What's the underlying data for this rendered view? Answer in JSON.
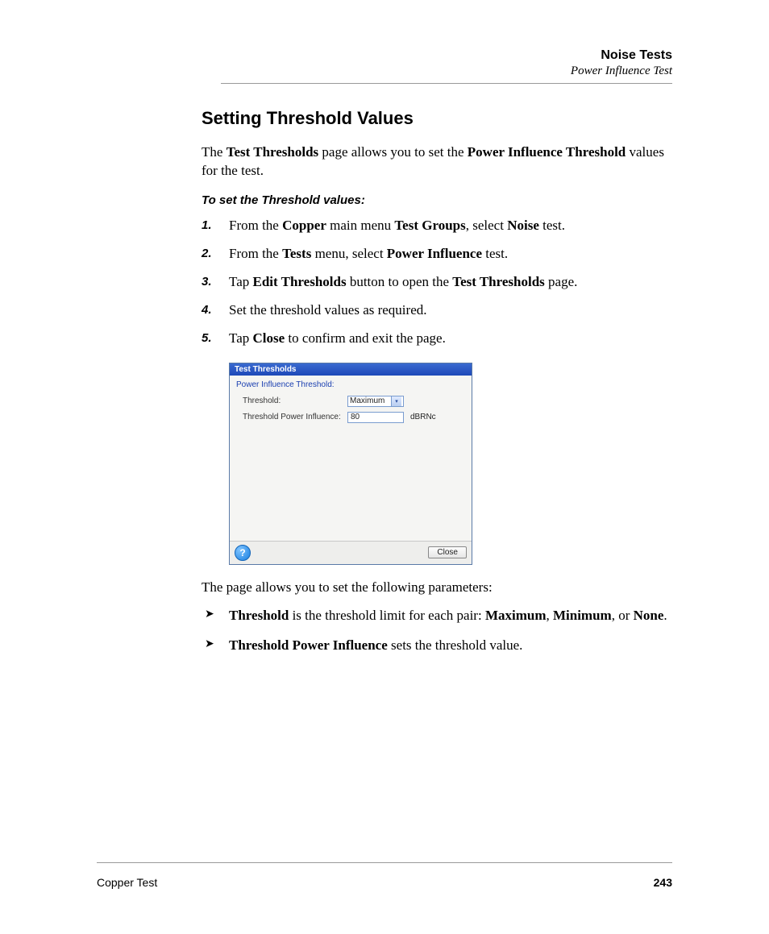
{
  "header": {
    "chapter": "Noise Tests",
    "subtitle": "Power Influence Test"
  },
  "section": {
    "title": "Setting Threshold Values",
    "intro_pre": "The ",
    "intro_b1": "Test Thresholds",
    "intro_mid": " page allows you to set the ",
    "intro_b2": "Power Influence Threshold",
    "intro_post": " values for the test.",
    "subhead": "To set the Threshold values:"
  },
  "steps": {
    "s1_a": "From the ",
    "s1_b1": "Copper",
    "s1_b": " main menu ",
    "s1_b2": "Test Groups",
    "s1_c": ", select ",
    "s1_b3": "Noise",
    "s1_d": " test.",
    "s2_a": "From the ",
    "s2_b1": "Tests",
    "s2_b": " menu, select ",
    "s2_b2": "Power Influence",
    "s2_c": " test.",
    "s3_a": "Tap ",
    "s3_b1": "Edit Thresholds",
    "s3_b": " button to open the ",
    "s3_b2": "Test Thresholds",
    "s3_c": " page.",
    "s4": "Set the threshold values as required.",
    "s5_a": "Tap ",
    "s5_b1": "Close",
    "s5_b": " to confirm and exit the page."
  },
  "app": {
    "title": "Test Thresholds",
    "group": "Power Influence Threshold:",
    "row1_label": "Threshold:",
    "row1_value": "Maximum",
    "row2_label": "Threshold Power Influence:",
    "row2_value": "80",
    "row2_unit": "dBRNc",
    "help": "?",
    "close": "Close"
  },
  "after": "The page allows you to set the following parameters:",
  "bullets": {
    "b1_b1": "Threshold",
    "b1_a": " is the threshold limit for each pair: ",
    "b1_b2": "Maximum",
    "b1_b": ", ",
    "b1_b3": "Minimum",
    "b1_c": ", or ",
    "b1_b4": "None",
    "b1_d": ".",
    "b2_b1": "Threshold Power Influence",
    "b2_a": " sets the threshold value."
  },
  "footer": {
    "left": "Copper Test",
    "page": "243"
  }
}
